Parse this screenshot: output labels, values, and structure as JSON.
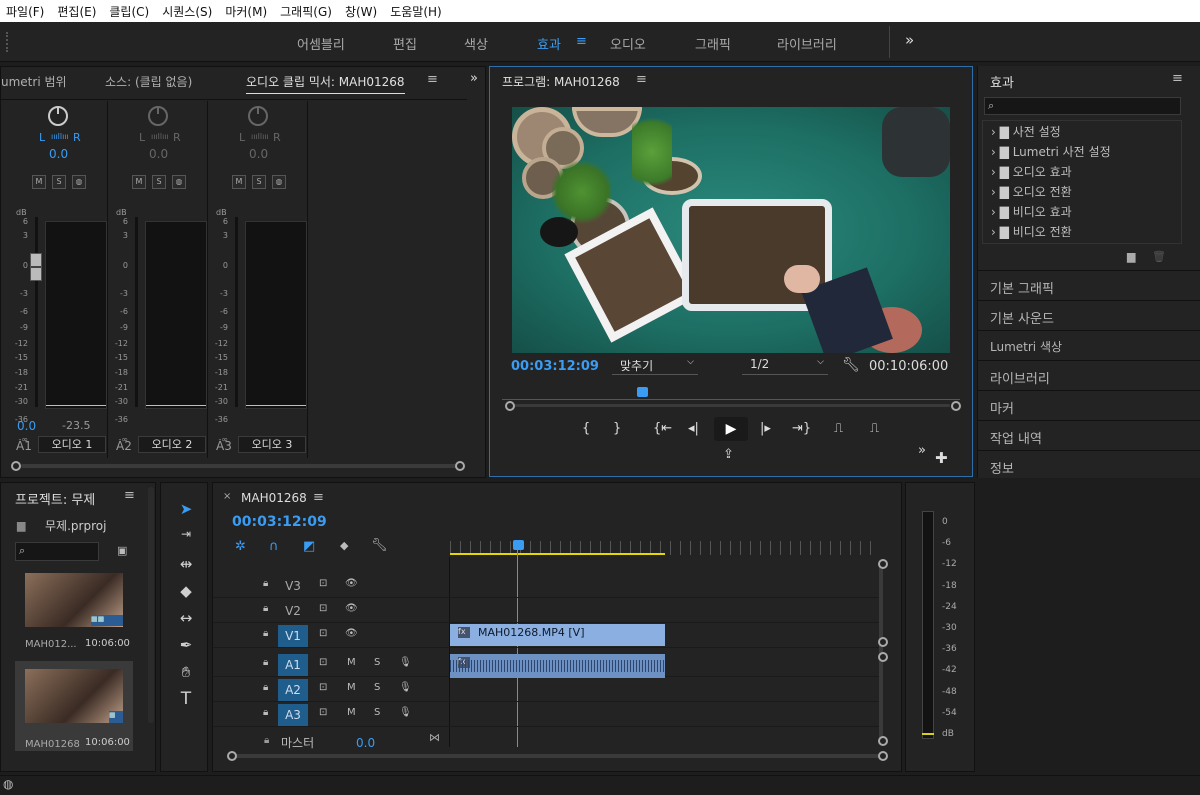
{
  "menubar": {
    "items": [
      "파일(F)",
      "편집(E)",
      "클립(C)",
      "시퀀스(S)",
      "마커(M)",
      "그래픽(G)",
      "창(W)",
      "도움말(H)"
    ]
  },
  "workspaces": {
    "items": [
      "어셈블리",
      "편집",
      "색상",
      "효과",
      "오디오",
      "그래픽",
      "라이브러리"
    ],
    "active": "효과",
    "more": "»"
  },
  "mixer": {
    "tabs": [
      "umetri 범위",
      "소스: (클립 없음)",
      "오디오 클립 믹서: MAH01268"
    ],
    "more": "»",
    "channels": [
      {
        "id": "A1",
        "name": "오디오 1",
        "pan": "0.0",
        "l": "L",
        "r": "R",
        "vol": "0.0",
        "peak": "-23.5"
      },
      {
        "id": "A2",
        "name": "오디오 2",
        "pan": "0.0",
        "l": "L",
        "r": "R",
        "vol": "",
        "peak": ""
      },
      {
        "id": "A3",
        "name": "오디오 3",
        "pan": "0.0",
        "l": "L",
        "r": "R",
        "vol": "",
        "peak": ""
      }
    ],
    "msr": [
      "M",
      "S",
      "◍"
    ],
    "db_label": "dB",
    "db_ticks": [
      "6",
      "3",
      "0",
      "-3",
      "-6",
      "-9",
      "-12",
      "-15",
      "-18",
      "-21",
      "-30",
      "-36",
      "-∞"
    ]
  },
  "program": {
    "title": "프로그램: MAH01268",
    "timecode": "00:03:12:09",
    "fit": "맞추기",
    "resolution": "1/2",
    "duration": "00:10:06:00",
    "playhead": 0.305
  },
  "effects": {
    "title": "효과",
    "search_placeholder": "",
    "tree": [
      "사전 설정",
      "Lumetri 사전 설정",
      "오디오 효과",
      "오디오 전환",
      "비디오 효과",
      "비디오 전환"
    ],
    "sections": [
      "기본 그래픽",
      "기본 사운드",
      "Lumetri 색상",
      "라이브러리",
      "마커",
      "작업 내역",
      "정보"
    ]
  },
  "project": {
    "title": "프로젝트: 무제",
    "file": "무제.prproj",
    "search_placeholder": "",
    "items": [
      {
        "name": "MAH012...",
        "duration": "10:06:00"
      },
      {
        "name": "MAH01268",
        "duration": "10:06:00"
      }
    ]
  },
  "timeline": {
    "title": "MAH01268",
    "timecode": "00:03:12:09",
    "tracks": [
      {
        "id": "V3",
        "on": false
      },
      {
        "id": "V2",
        "on": false
      },
      {
        "id": "V1",
        "on": true
      },
      {
        "id": "A1",
        "on": true
      },
      {
        "id": "A2",
        "on": true
      },
      {
        "id": "A3",
        "on": true
      }
    ],
    "clip_label": "MAH01268.MP4 [V]",
    "master_label": "마스터",
    "master_value": "0.0",
    "ms": [
      "M",
      "S"
    ]
  },
  "audio_meter": {
    "ticks": [
      "0",
      "-6",
      "-12",
      "-18",
      "-24",
      "-30",
      "-36",
      "-42",
      "-48",
      "-54",
      "dB"
    ]
  }
}
